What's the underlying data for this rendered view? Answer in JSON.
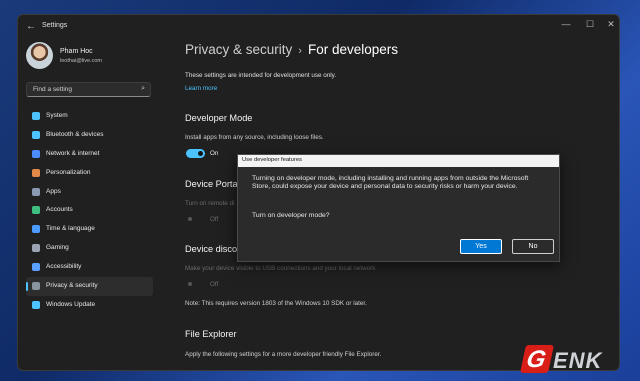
{
  "window": {
    "title": "Settings",
    "controls": {
      "minimize": "—",
      "maximize": "☐",
      "close": "✕"
    }
  },
  "profile": {
    "name": "Pham Hoc",
    "email": "leothai@live.com"
  },
  "search": {
    "placeholder": "Find a setting"
  },
  "sidebar": {
    "items": [
      {
        "label": "System",
        "icon": "monitor-icon",
        "color": "#4cc2ff"
      },
      {
        "label": "Bluetooth & devices",
        "icon": "bluetooth-icon",
        "color": "#4cc2ff"
      },
      {
        "label": "Network & internet",
        "icon": "wifi-icon",
        "color": "#4c8cff"
      },
      {
        "label": "Personalization",
        "icon": "brush-icon",
        "color": "#e38a4a"
      },
      {
        "label": "Apps",
        "icon": "apps-icon",
        "color": "#8a9ab0"
      },
      {
        "label": "Accounts",
        "icon": "person-icon",
        "color": "#3fbf7f"
      },
      {
        "label": "Time & language",
        "icon": "globe-icon",
        "color": "#4c9cff"
      },
      {
        "label": "Gaming",
        "icon": "gamepad-icon",
        "color": "#9aa4b4"
      },
      {
        "label": "Accessibility",
        "icon": "accessibility-icon",
        "color": "#5aa0ff"
      },
      {
        "label": "Privacy & security",
        "icon": "shield-icon",
        "color": "#8a949e",
        "active": true
      },
      {
        "label": "Windows Update",
        "icon": "update-icon",
        "color": "#4cc2ff"
      }
    ]
  },
  "main": {
    "breadcrumb_parent": "Privacy & security",
    "breadcrumb_sep": "›",
    "breadcrumb_current": "For developers",
    "intro": "These settings are intended for development use only.",
    "learn_more": "Learn more",
    "developer_mode": {
      "title": "Developer Mode",
      "desc": "Install apps from any source, including loose files.",
      "state": "On"
    },
    "device_portal": {
      "title": "Device Porta",
      "desc": "Turn on remote di",
      "state": "Off"
    },
    "device_discovery": {
      "title": "Device disco",
      "desc": "Make your device visible to USB connections and your local network",
      "state": "Off",
      "note": "Note: This requires version 1803 of the Windows 10 SDK or later."
    },
    "file_explorer": {
      "title": "File Explorer",
      "desc": "Apply the following settings for a more developer friendly File Explorer."
    }
  },
  "dialog": {
    "title": "Use developer features",
    "message": "Turning on developer mode, including installing and running apps from outside the Microsoft Store, could expose your device and personal data to security risks or harm your device.",
    "question": "Turn on developer mode?",
    "yes": "Yes",
    "no": "No"
  },
  "watermark": {
    "first": "G",
    "rest": "ENK"
  }
}
